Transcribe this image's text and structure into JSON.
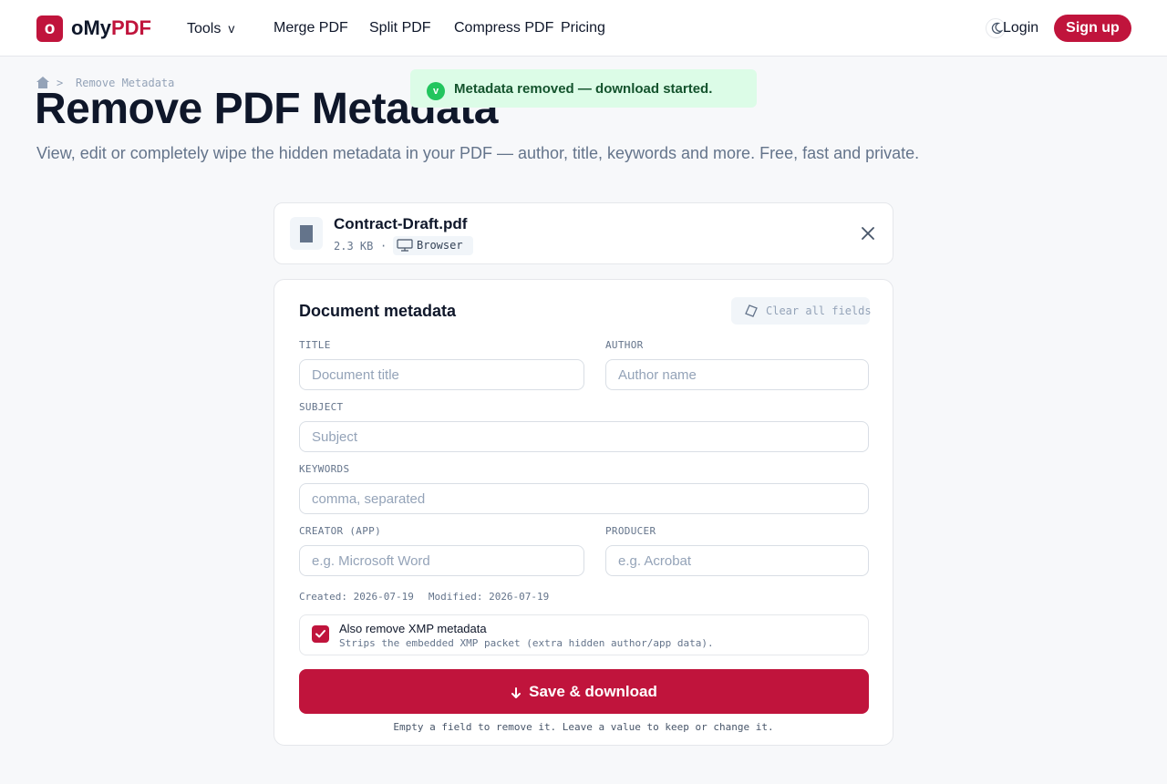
{
  "header": {
    "logo_mark": "o",
    "logo_text_plain": "oMy",
    "logo_text_accent": "PDF",
    "nav": {
      "tools": "Tools",
      "tools_caret": "v",
      "merge": "Merge PDF",
      "split": "Split PDF",
      "compress": "Compress PDF",
      "pricing": "Pricing"
    },
    "login": "Login",
    "signup": "Sign up"
  },
  "toast": {
    "icon_text": "v",
    "message": "Metadata removed — download started."
  },
  "breadcrumb": {
    "separator": ">",
    "current": "Remove Metadata"
  },
  "page": {
    "title": "Remove PDF Metadata",
    "subtitle": "View, edit or completely wipe the hidden metadata in your PDF — author, title, keywords and more. Free, fast and private."
  },
  "file": {
    "name": "Contract-Draft.pdf",
    "size": "2.3 KB",
    "separator": "·",
    "source": "Browser"
  },
  "form": {
    "heading": "Document metadata",
    "clear_label": "Clear all fields",
    "fields": {
      "title": {
        "label": "TITLE",
        "value": "",
        "placeholder": "Document title"
      },
      "author": {
        "label": "AUTHOR",
        "value": "",
        "placeholder": "Author name"
      },
      "subject": {
        "label": "SUBJECT",
        "value": "",
        "placeholder": "Subject"
      },
      "keywords": {
        "label": "KEYWORDS",
        "value": "",
        "placeholder": "comma, separated"
      },
      "creator": {
        "label": "CREATOR (APP)",
        "value": "",
        "placeholder": "e.g. Microsoft Word"
      },
      "producer": {
        "label": "PRODUCER",
        "value": "",
        "placeholder": "e.g. Acrobat"
      }
    },
    "created": "Created: 2026-07-19",
    "modified": "Modified: 2026-07-19",
    "xmp": {
      "checked": true,
      "title": "Also remove XMP metadata",
      "description": "Strips the embedded XMP packet (extra hidden author/app data)."
    },
    "save_label": "Save & download",
    "footnote": "Empty a field to remove it. Leave a value to keep or change it."
  },
  "colors": {
    "brand": "#c0143c",
    "success_bg": "#dcfce7",
    "success_icon": "#22c55e",
    "success_text": "#14532d"
  },
  "icons": {
    "theme": "moon-icon",
    "home": "home-icon",
    "file": "file-icon",
    "browser": "monitor-icon",
    "close": "close-icon",
    "clear": "eraser-icon",
    "check": "check-icon",
    "download": "download-arrow-icon"
  }
}
